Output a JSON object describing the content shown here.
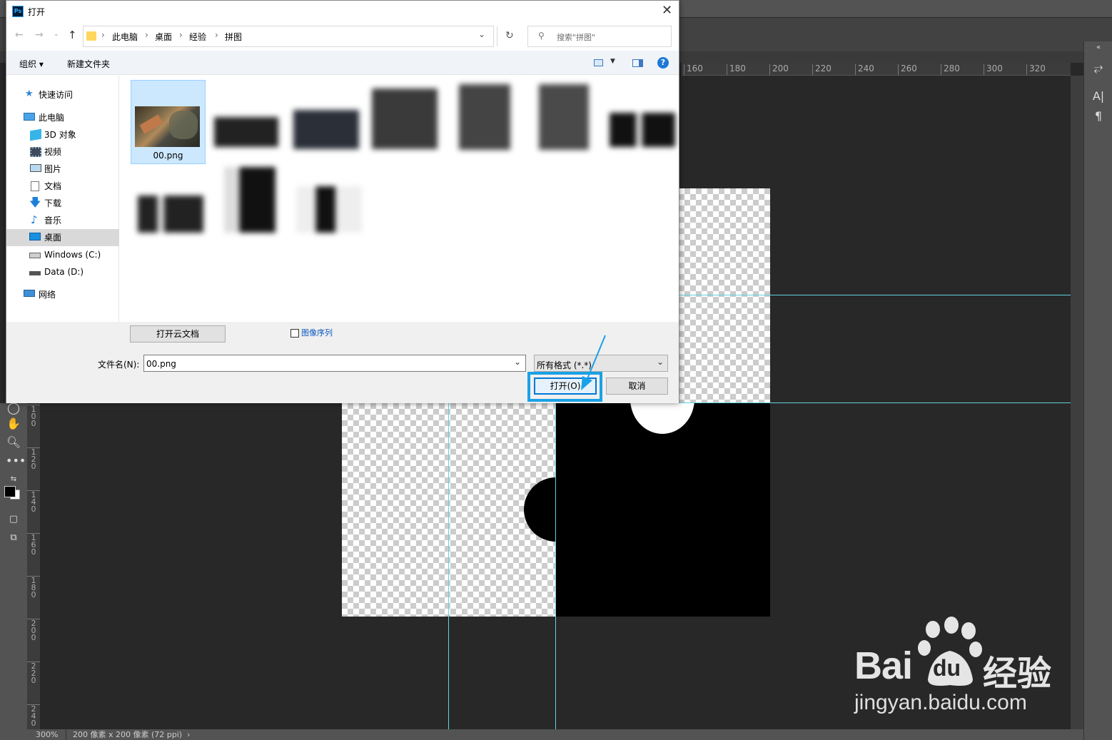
{
  "dialog": {
    "title": "打开",
    "breadcrumb": [
      "此电脑",
      "桌面",
      "经验",
      "拼图"
    ],
    "search_placeholder": "搜索\"拼图\"",
    "toolbar": {
      "organize": "组织",
      "new_folder": "新建文件夹"
    },
    "nav": {
      "quick_access": "快速访问",
      "this_pc": "此电脑",
      "objects_3d": "3D 对象",
      "videos": "视频",
      "pictures": "图片",
      "documents": "文档",
      "downloads": "下载",
      "music": "音乐",
      "desktop": "桌面",
      "drive_c": "Windows (C:)",
      "drive_d": "Data (D:)",
      "network": "网络"
    },
    "selected_file_label": "00.png",
    "cloud_button": "打开云文档",
    "image_sequence_label": "图像序列",
    "filename_label": "文件名(N):",
    "filename_value": "00.png",
    "filetype_value": "所有格式 (*.*)",
    "open_button": "打开(O)",
    "cancel_button": "取消"
  },
  "photoshop": {
    "ruler_h_ticks": [
      "160",
      "180",
      "200",
      "220",
      "240",
      "260",
      "280",
      "300",
      "320"
    ],
    "ruler_v_ticks": [
      "1\n0\n0",
      "1\n2\n0",
      "1\n4\n0",
      "1\n6\n0",
      "1\n8\n0",
      "2\n0\n0",
      "2\n2\n0",
      "2\n4\n0"
    ],
    "status_zoom": "300%",
    "status_doc": "200 像素 x 200 像素 (72 ppi)",
    "status_arrow": "›",
    "app_badge": "Ps"
  },
  "watermark": {
    "brand": "Bai",
    "brand2": "du",
    "cn": "经验",
    "url": "jingyan.baidu.com"
  },
  "colors": {
    "guide": "#5fd3e0",
    "highlight": "#1aa1e6",
    "selection": "#cce8ff"
  }
}
